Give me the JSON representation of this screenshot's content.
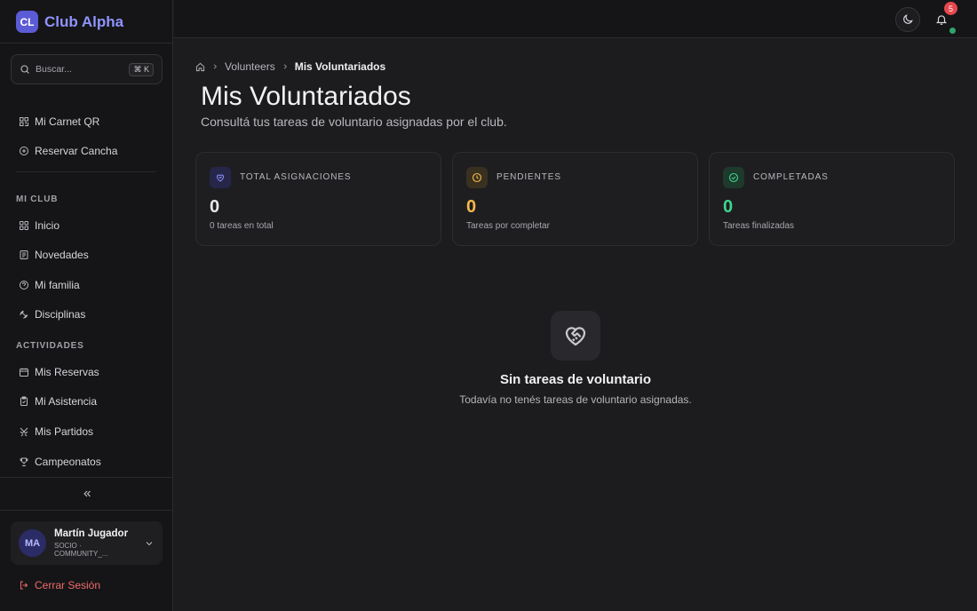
{
  "brand": {
    "logo_text": "CL",
    "name": "Club Alpha"
  },
  "search": {
    "placeholder": "Buscar...",
    "shortcut": "⌘ K"
  },
  "sidebar": {
    "quick_items": [
      {
        "label": "Mi Carnet QR",
        "icon": "qr-code-icon"
      },
      {
        "label": "Reservar Cancha",
        "icon": "plus-circle-icon"
      }
    ],
    "sections": [
      {
        "title": "MI CLUB",
        "items": [
          {
            "label": "Inicio",
            "icon": "grid-icon"
          },
          {
            "label": "Novedades",
            "icon": "newspaper-icon"
          },
          {
            "label": "Mi familia",
            "icon": "family-icon"
          },
          {
            "label": "Disciplinas",
            "icon": "dumbbell-icon"
          }
        ]
      },
      {
        "title": "ACTIVIDADES",
        "items": [
          {
            "label": "Mis Reservas",
            "icon": "calendar-icon"
          },
          {
            "label": "Mi Asistencia",
            "icon": "clipboard-check-icon"
          },
          {
            "label": "Mis Partidos",
            "icon": "swords-icon"
          },
          {
            "label": "Campeonatos",
            "icon": "trophy-icon"
          }
        ]
      }
    ]
  },
  "user": {
    "initials": "MA",
    "name": "Martín Jugador",
    "role": "SOCIO · COMMUNITY_..."
  },
  "logout_label": "Cerrar Sesión",
  "notifications": {
    "count": "5"
  },
  "breadcrumb": {
    "parent": "Volunteers",
    "current": "Mis Voluntariados"
  },
  "page": {
    "title": "Mis Voluntariados",
    "subtitle": "Consultá tus tareas de voluntario asignadas por el club."
  },
  "stats": [
    {
      "label": "TOTAL ASIGNACIONES",
      "value": "0",
      "desc": "0 tareas en total",
      "color": "#e7e7ea",
      "accent": "#8f93ff",
      "icon": "heart-hand-icon"
    },
    {
      "label": "PENDIENTES",
      "value": "0",
      "desc": "Tareas por completar",
      "color": "#f5b84a",
      "accent": "#f5b84a",
      "icon": "clock-icon"
    },
    {
      "label": "COMPLETADAS",
      "value": "0",
      "desc": "Tareas finalizadas",
      "color": "#3dd68c",
      "accent": "#3dd68c",
      "icon": "check-circle-icon"
    }
  ],
  "empty_state": {
    "title": "Sin tareas de voluntario",
    "description": "Todavía no tenés tareas de voluntario asignadas.",
    "icon": "heart-handshake-icon"
  }
}
